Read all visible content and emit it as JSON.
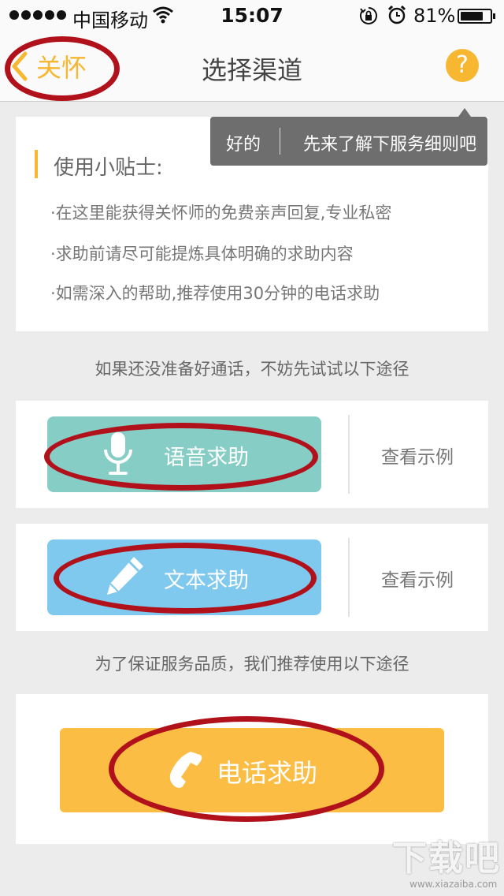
{
  "status_bar": {
    "carrier": "中国移动",
    "time": "15:07",
    "battery": "81%",
    "battery_level": 0.81
  },
  "nav": {
    "back_label": "关怀",
    "title": "选择渠道",
    "help_label": "?"
  },
  "tooltip": {
    "ok_label": "好的",
    "learn_label": "先来了解下服务细则吧"
  },
  "tips": {
    "title": "使用小贴士:",
    "items": [
      "·在这里能获得关怀师的免费亲声回复,专业私密",
      "·求助前请尽可能提炼具体明确的求助内容",
      "·如需深入的帮助,推荐使用30分钟的电话求助"
    ]
  },
  "hint_top": "如果还没准备好通话，不妨先试试以下途径",
  "options": [
    {
      "label": "语音求助",
      "example": "查看示例",
      "color": "#86cdc6",
      "icon": "microphone-icon"
    },
    {
      "label": "文本求助",
      "example": "查看示例",
      "color": "#80c9ee",
      "icon": "pencil-icon"
    }
  ],
  "hint_bottom": "为了保证服务品质，我们推荐使用以下途径",
  "phone": {
    "label": "电话求助",
    "color": "#fbbd44",
    "icon": "phone-icon"
  },
  "colors": {
    "accent": "#f7b731",
    "annotation": "#b1111b",
    "tooltip_bg": "#6e6e6e"
  },
  "watermark": {
    "text": "下载吧",
    "url": "www.xiazaiba.com"
  }
}
